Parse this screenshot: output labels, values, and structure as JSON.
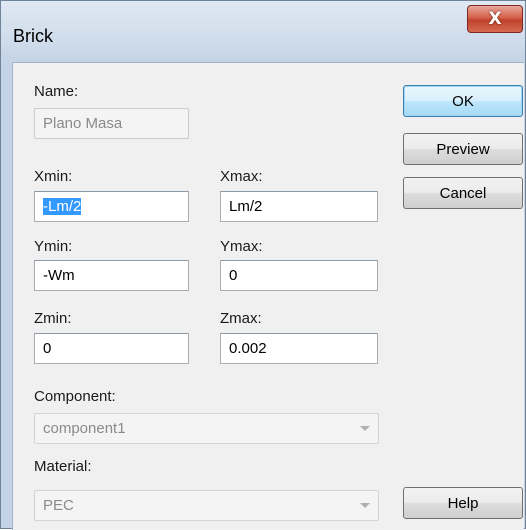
{
  "window": {
    "title": "Brick",
    "close_glyph": "X"
  },
  "fields": {
    "name": {
      "label": "Name:",
      "value": "Plano Masa"
    },
    "xmin": {
      "label": "Xmin:",
      "value": "-Lm/2"
    },
    "xmax": {
      "label": "Xmax:",
      "value": "Lm/2"
    },
    "ymin": {
      "label": "Ymin:",
      "value": "-Wm"
    },
    "ymax": {
      "label": "Ymax:",
      "value": "0"
    },
    "zmin": {
      "label": "Zmin:",
      "value": "0"
    },
    "zmax": {
      "label": "Zmax:",
      "value": "0.002"
    },
    "component": {
      "label": "Component:",
      "value": "component1"
    },
    "material": {
      "label": "Material:",
      "value": "PEC"
    }
  },
  "buttons": {
    "ok": "OK",
    "preview": "Preview",
    "cancel": "Cancel",
    "help": "Help"
  },
  "icons": {
    "close": "close-icon",
    "dropdown": "chevron-down-icon"
  },
  "colors": {
    "selection": "#3399ff",
    "close_button": "#c0422c",
    "default_button_border": "#3c7fb1"
  }
}
